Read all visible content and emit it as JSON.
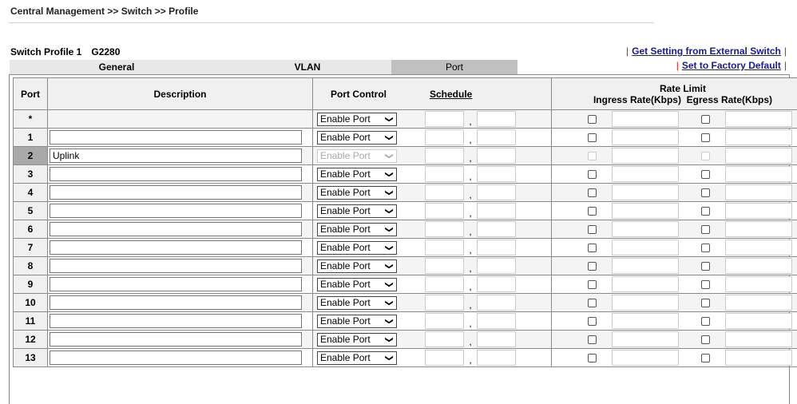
{
  "breadcrumb": "Central Management >> Switch >> Profile",
  "profile": {
    "label": "Switch Profile 1",
    "model": "G2280"
  },
  "links": {
    "get_setting": "Get Setting from External Switch",
    "factory_default": "Set to Factory Default"
  },
  "tabs": [
    {
      "label": "General"
    },
    {
      "label": "VLAN"
    },
    {
      "label": "Port"
    }
  ],
  "table": {
    "headers": {
      "port": "Port",
      "description": "Description",
      "port_control": "Port Control",
      "schedule": "Schedule",
      "rate_limit": "Rate Limit",
      "ingress": "Ingress Rate(Kbps)",
      "egress": "Egress Rate(Kbps)"
    },
    "comma": ",",
    "select_value": "Enable Port",
    "rows": [
      {
        "port": "*",
        "description": "",
        "select_value": "Enable Port"
      },
      {
        "port": "1",
        "description": "",
        "select_value": "Enable Port"
      },
      {
        "port": "2",
        "description": "Uplink",
        "select_value": "Enable Port"
      },
      {
        "port": "3",
        "description": "",
        "select_value": "Enable Port"
      },
      {
        "port": "4",
        "description": "",
        "select_value": "Enable Port"
      },
      {
        "port": "5",
        "description": "",
        "select_value": "Enable Port"
      },
      {
        "port": "6",
        "description": "",
        "select_value": "Enable Port"
      },
      {
        "port": "7",
        "description": "",
        "select_value": "Enable Port"
      },
      {
        "port": "8",
        "description": "",
        "select_value": "Enable Port"
      },
      {
        "port": "9",
        "description": "",
        "select_value": "Enable Port"
      },
      {
        "port": "10",
        "description": "",
        "select_value": "Enable Port"
      },
      {
        "port": "11",
        "description": "",
        "select_value": "Enable Port"
      },
      {
        "port": "12",
        "description": "",
        "select_value": "Enable Port"
      },
      {
        "port": "13",
        "description": "",
        "select_value": "Enable Port"
      }
    ]
  },
  "colors": {
    "link": "#1a1a8c",
    "separator": "#dd1111",
    "tab_selected": "#c0c0c0",
    "highlight_port": "#a9a9a9"
  }
}
